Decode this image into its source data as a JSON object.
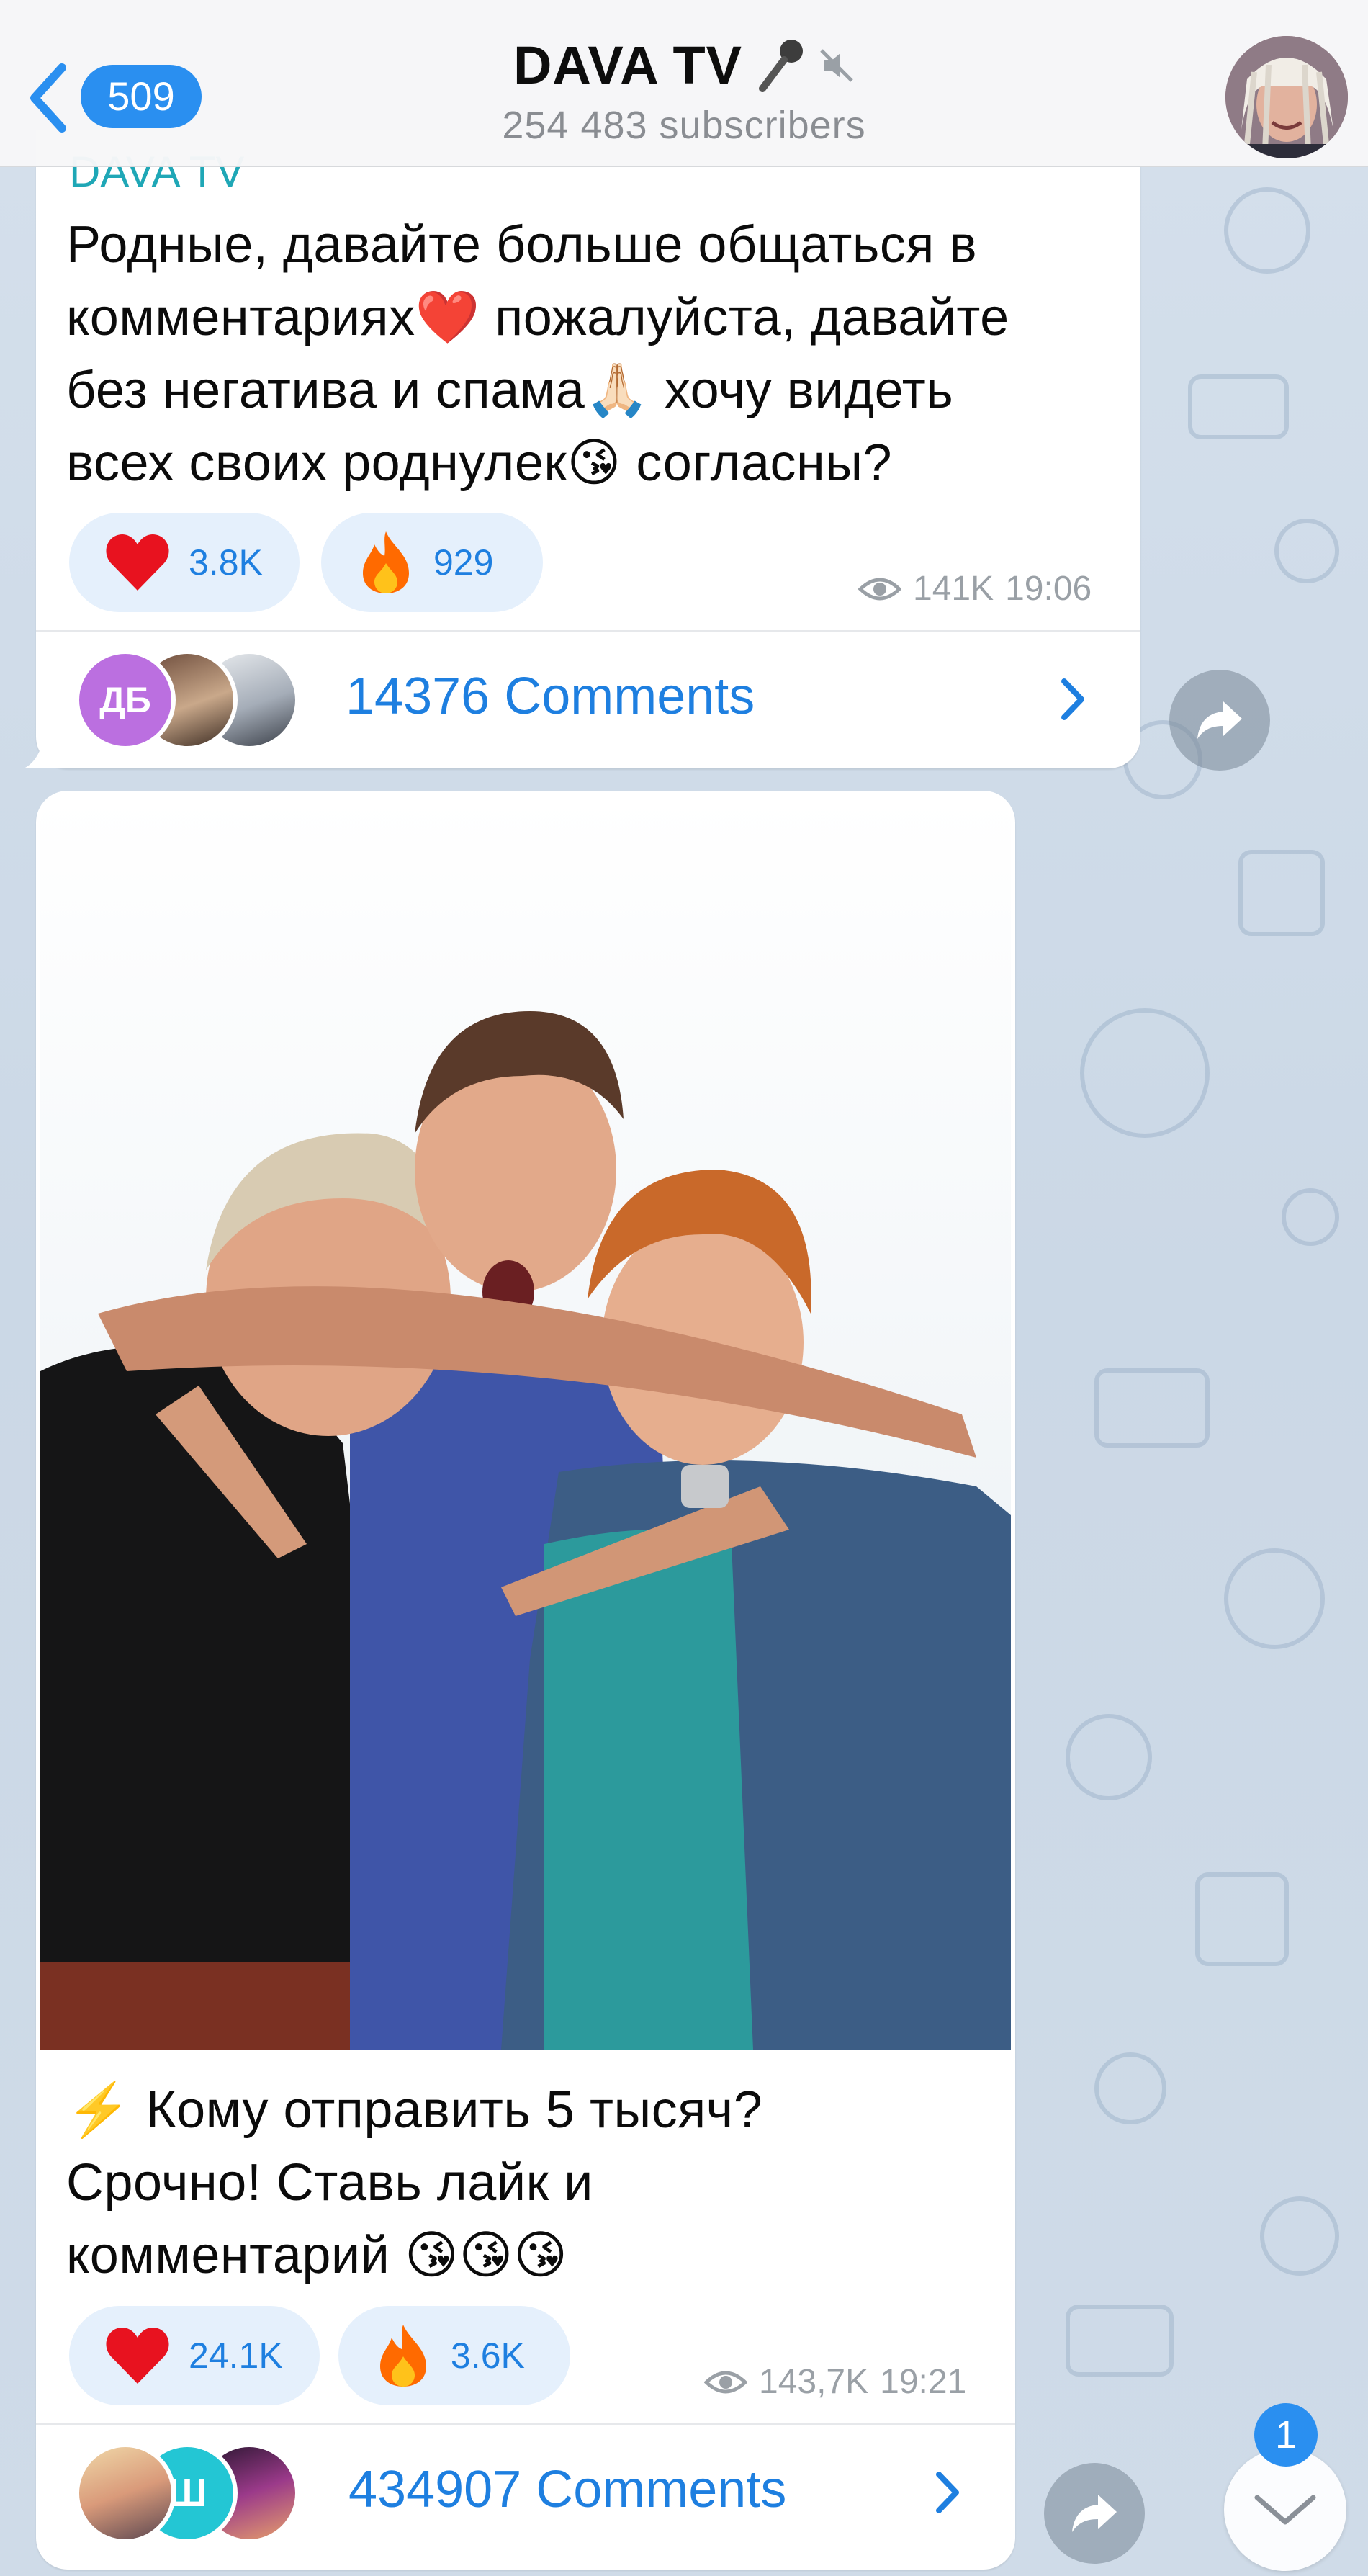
{
  "header": {
    "back_badge": "509",
    "title": "DAVA TV",
    "subscribers": "254 483 subscribers"
  },
  "messages": [
    {
      "sender": "DAVA TV",
      "text_lines": [
        "Родные, давайте больше общаться в",
        "комментариях❤️ пожалуйста, давайте",
        "без негатива и спама🙏🏻 хочу видеть",
        "всех своих роднулек😘 согласны?"
      ],
      "reactions": [
        {
          "icon": "heart-icon",
          "count": "3.8K"
        },
        {
          "icon": "fire-icon",
          "count": "929"
        }
      ],
      "views": "141K",
      "time": "19:06",
      "comment_avatar_initials": "ДБ",
      "comments": "14376 Comments"
    },
    {
      "text_lines": [
        "⚡️ Кому отправить 5 тысяч?",
        "Срочно! Ставь лайк и",
        "комментарий 😘😘😘"
      ],
      "reactions": [
        {
          "icon": "heart-icon",
          "count": "24.1K"
        },
        {
          "icon": "fire-icon",
          "count": "3.6K"
        }
      ],
      "views": "143,7K",
      "time": "19:21",
      "comment_avatar_initials": "Ш",
      "comments": "434907 Comments"
    }
  ],
  "scroll_badge": "1",
  "colors": {
    "accent": "#2a8ff0",
    "link": "#1e7fe0",
    "sender": "#1fa7b6",
    "reaction_bg": "#e5f0fc",
    "wallpaper": "#cfdbe8"
  }
}
